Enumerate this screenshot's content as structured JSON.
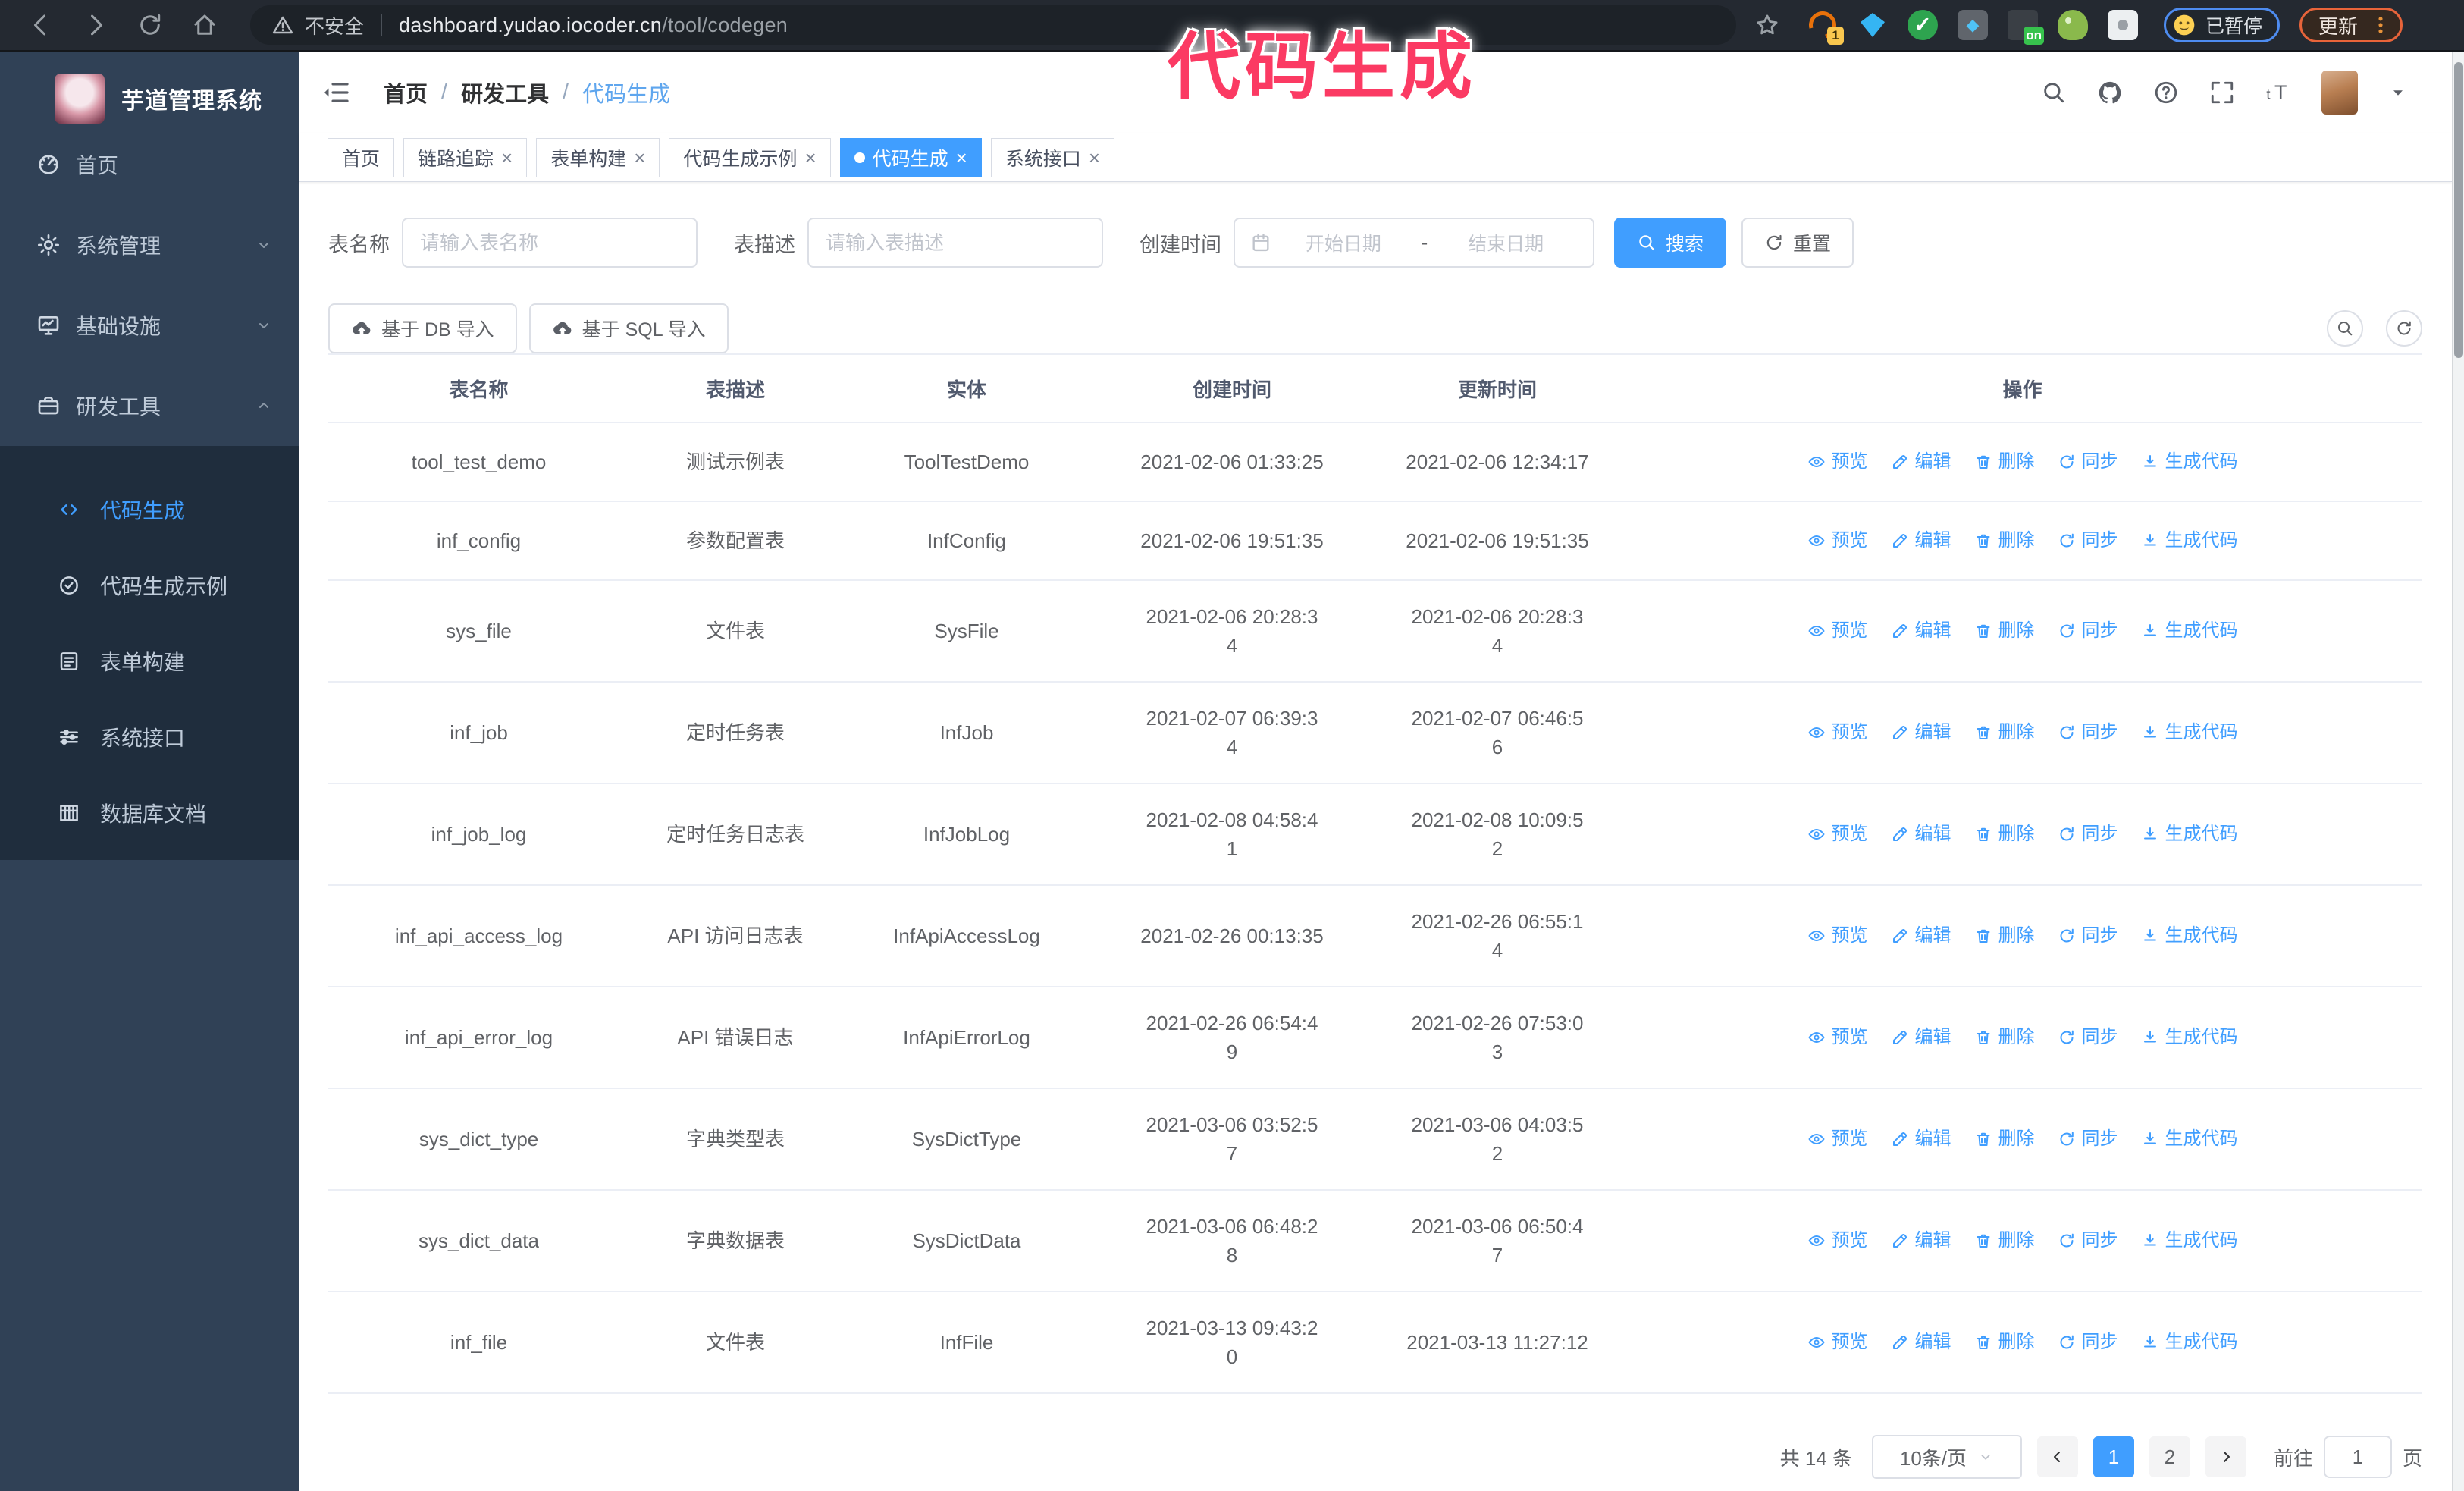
{
  "colors": {
    "primary": "#409eff",
    "annotation": "#fb3a63",
    "sidebar_bg": "#304156",
    "submenu_bg": "#1f2d3d"
  },
  "browser": {
    "security_label": "不安全",
    "url_domain": "dashboard.yudao.iocoder.cn",
    "url_path": "/tool/codegen",
    "extensions": [
      {
        "name": "orange",
        "badge": "1"
      },
      {
        "name": "gem"
      },
      {
        "name": "check"
      },
      {
        "name": "grid"
      },
      {
        "name": "onbadge",
        "badge": "on"
      },
      {
        "name": "android"
      },
      {
        "name": "puzzle"
      }
    ],
    "paused_badge": "已暂停",
    "update_label": "更新"
  },
  "annotation": {
    "text": "代码生成"
  },
  "sidebar": {
    "title": "芋道管理系统",
    "menu": [
      {
        "label": "首页",
        "icon": "gauge"
      },
      {
        "label": "系统管理",
        "icon": "gear",
        "chevron": "down"
      },
      {
        "label": "基础设施",
        "icon": "monitor",
        "chevron": "down"
      },
      {
        "label": "研发工具",
        "icon": "toolbox",
        "chevron": "up",
        "expanded": true
      }
    ],
    "submenu": [
      {
        "label": "代码生成",
        "icon": "code",
        "active": true
      },
      {
        "label": "代码生成示例",
        "icon": "check-badge"
      },
      {
        "label": "表单构建",
        "icon": "form"
      },
      {
        "label": "系统接口",
        "icon": "sliders"
      },
      {
        "label": "数据库文档",
        "icon": "db-table"
      }
    ]
  },
  "header": {
    "breadcrumb": [
      "首页",
      "研发工具",
      "代码生成"
    ]
  },
  "tabs": [
    {
      "label": "首页",
      "closable": false,
      "active": false
    },
    {
      "label": "链路追踪",
      "closable": true,
      "active": false
    },
    {
      "label": "表单构建",
      "closable": true,
      "active": false
    },
    {
      "label": "代码生成示例",
      "closable": true,
      "active": false
    },
    {
      "label": "代码生成",
      "closable": true,
      "active": true
    },
    {
      "label": "系统接口",
      "closable": true,
      "active": false
    }
  ],
  "search": {
    "name_label": "表名称",
    "name_placeholder": "请输入表名称",
    "desc_label": "表描述",
    "desc_placeholder": "请输入表描述",
    "time_label": "创建时间",
    "start_placeholder": "开始日期",
    "range_separator": "-",
    "end_placeholder": "结束日期",
    "search_label": "搜索",
    "reset_label": "重置"
  },
  "toolbar": {
    "db_import_label": "基于 DB 导入",
    "sql_import_label": "基于 SQL 导入"
  },
  "table": {
    "headers": [
      "表名称",
      "表描述",
      "实体",
      "创建时间",
      "更新时间",
      "操作"
    ],
    "action_labels": [
      {
        "label": "预览",
        "icon": "eye"
      },
      {
        "label": "编辑",
        "icon": "edit"
      },
      {
        "label": "删除",
        "icon": "delete"
      },
      {
        "label": "同步",
        "icon": "sync"
      },
      {
        "label": "生成代码",
        "icon": "download"
      }
    ],
    "rows": [
      {
        "name": "tool_test_demo",
        "desc": "测试示例表",
        "entity": "ToolTestDemo",
        "created": "2021-02-06 01:33:25",
        "updated": "2021-02-06 12:34:17",
        "tall": false
      },
      {
        "name": "inf_config",
        "desc": "参数配置表",
        "entity": "InfConfig",
        "created": "2021-02-06 19:51:35",
        "updated": "2021-02-06 19:51:35",
        "tall": false
      },
      {
        "name": "sys_file",
        "desc": "文件表",
        "entity": "SysFile",
        "created": "2021-02-06 20:28:3\n4",
        "updated": "2021-02-06 20:28:3\n4",
        "tall": true
      },
      {
        "name": "inf_job",
        "desc": "定时任务表",
        "entity": "InfJob",
        "created": "2021-02-07 06:39:3\n4",
        "updated": "2021-02-07 06:46:5\n6",
        "tall": true
      },
      {
        "name": "inf_job_log",
        "desc": "定时任务日志表",
        "entity": "InfJobLog",
        "created": "2021-02-08 04:58:4\n1",
        "updated": "2021-02-08 10:09:5\n2",
        "tall": true
      },
      {
        "name": "inf_api_access_log",
        "desc": "API 访问日志表",
        "entity": "InfApiAccessLog",
        "created": "2021-02-26 00:13:35",
        "updated": "2021-02-26 06:55:1\n4",
        "tall": true
      },
      {
        "name": "inf_api_error_log",
        "desc": "API 错误日志",
        "entity": "InfApiErrorLog",
        "created": "2021-02-26 06:54:4\n9",
        "updated": "2021-02-26 07:53:0\n3",
        "tall": true
      },
      {
        "name": "sys_dict_type",
        "desc": "字典类型表",
        "entity": "SysDictType",
        "created": "2021-03-06 03:52:5\n7",
        "updated": "2021-03-06 04:03:5\n2",
        "tall": true
      },
      {
        "name": "sys_dict_data",
        "desc": "字典数据表",
        "entity": "SysDictData",
        "created": "2021-03-06 06:48:2\n8",
        "updated": "2021-03-06 06:50:4\n7",
        "tall": true
      },
      {
        "name": "inf_file",
        "desc": "文件表",
        "entity": "InfFile",
        "created": "2021-03-13 09:43:2\n0",
        "updated": "2021-03-13 11:27:12",
        "tall": true
      }
    ]
  },
  "pagination": {
    "total": "共 14 条",
    "page_size": "10条/页",
    "pages": [
      "1",
      "2"
    ],
    "active_page": "1",
    "goto_label": "前往",
    "goto_value": "1",
    "page_suffix": "页"
  }
}
